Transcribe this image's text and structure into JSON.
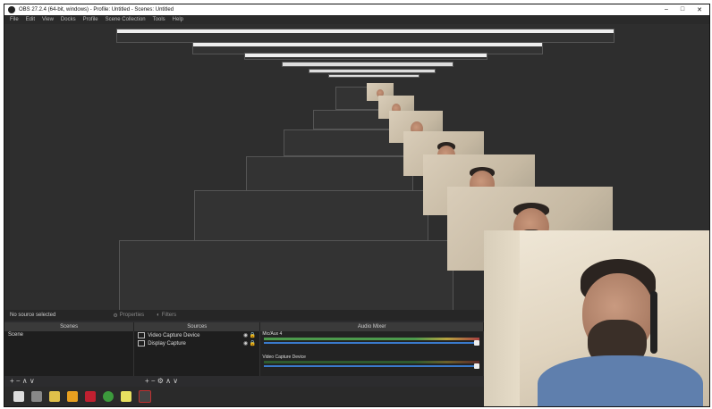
{
  "window": {
    "title": "OBS 27.2.4 (64-bit, windows) - Profile: Untitled - Scenes: Untitled",
    "minimize": "–",
    "maximize": "□",
    "close": "✕"
  },
  "menu": [
    "File",
    "Edit",
    "View",
    "Docks",
    "Profile",
    "Scene Collection",
    "Tools",
    "Help"
  ],
  "status": {
    "no_source": "No source selected",
    "properties": "Properties",
    "filters": "Filters"
  },
  "docks": {
    "scenes": {
      "title": "Scenes",
      "items": [
        "Scene"
      ]
    },
    "sources": {
      "title": "Sources",
      "items": [
        "Video Capture Device",
        "Display Capture"
      ]
    },
    "mixer": {
      "title": "Audio Mixer",
      "tracks": [
        "Mic/Aux 4",
        "Video Capture Device"
      ]
    }
  },
  "footer": {
    "scenes_tools": "+ − ∧ ∨",
    "sources_tools": "+ − ⚙ ∧ ∨"
  },
  "colors": {
    "accent": "#3a7acc",
    "meter_green": "#4c9a4c",
    "meter_yellow": "#b8a340",
    "meter_red": "#a84040"
  }
}
